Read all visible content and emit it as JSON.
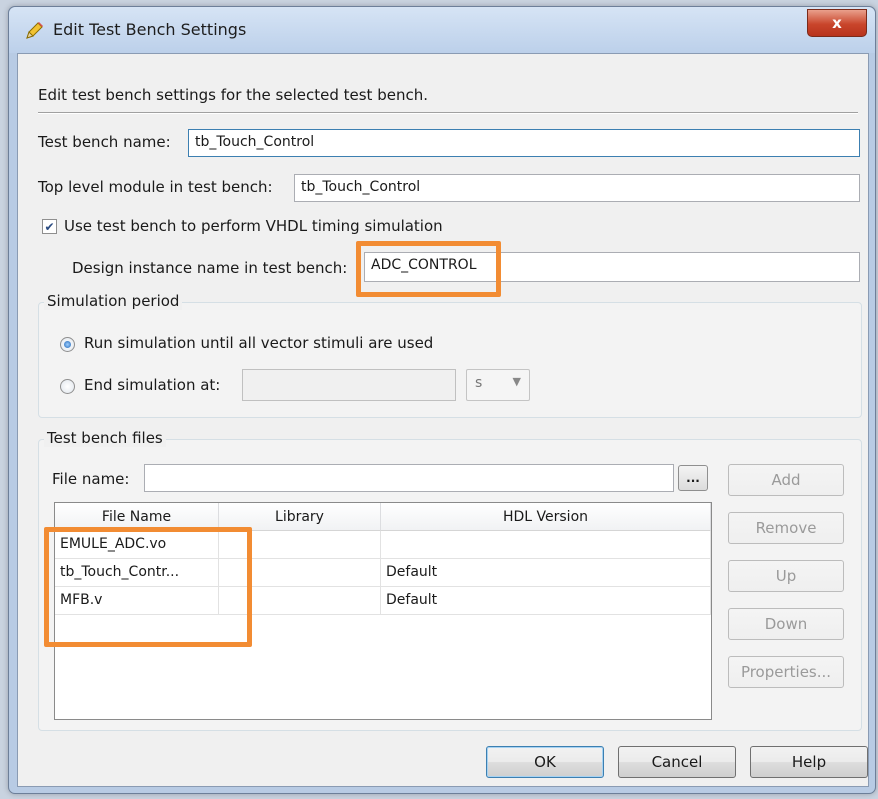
{
  "window": {
    "title": "Edit Test Bench Settings",
    "close_label": "x"
  },
  "description": "Edit test bench settings for the selected test bench.",
  "fields": {
    "test_bench_name_label": "Test bench name:",
    "test_bench_name_value": "tb_Touch_Control",
    "top_level_module_label": "Top level module in test bench:",
    "top_level_module_value": "tb_Touch_Control",
    "use_test_bench_label": "Use test bench to perform VHDL timing simulation",
    "use_test_bench_checked": true,
    "design_instance_label": "Design instance name in test bench:",
    "design_instance_value": "ADC_CONTROL"
  },
  "simulation_period": {
    "title": "Simulation period",
    "run_all_label": "Run simulation until all vector stimuli are used",
    "end_at_label": "End simulation at:",
    "end_at_value": "",
    "unit_value": "s",
    "selected": "run_all"
  },
  "test_bench_files": {
    "title": "Test bench files",
    "file_name_label": "File name:",
    "file_name_value": "",
    "browse_label": "...",
    "columns": [
      "File Name",
      "Library",
      "HDL Version"
    ],
    "rows": [
      [
        "EMULE_ADC.vo",
        "",
        ""
      ],
      [
        "tb_Touch_Contr...",
        "",
        "Default"
      ],
      [
        "MFB.v",
        "",
        "Default"
      ]
    ],
    "buttons": {
      "add": "Add",
      "remove": "Remove",
      "up": "Up",
      "down": "Down",
      "properties": "Properties..."
    }
  },
  "footer": {
    "ok": "OK",
    "cancel": "Cancel",
    "help": "Help"
  },
  "colors": {
    "highlight": "#f28c33",
    "title_bar": "#bcd0ea",
    "close_button": "#c9452b"
  },
  "icons": {
    "title_icon": "pencil-icon",
    "dropdown": "chevron-down-icon"
  }
}
